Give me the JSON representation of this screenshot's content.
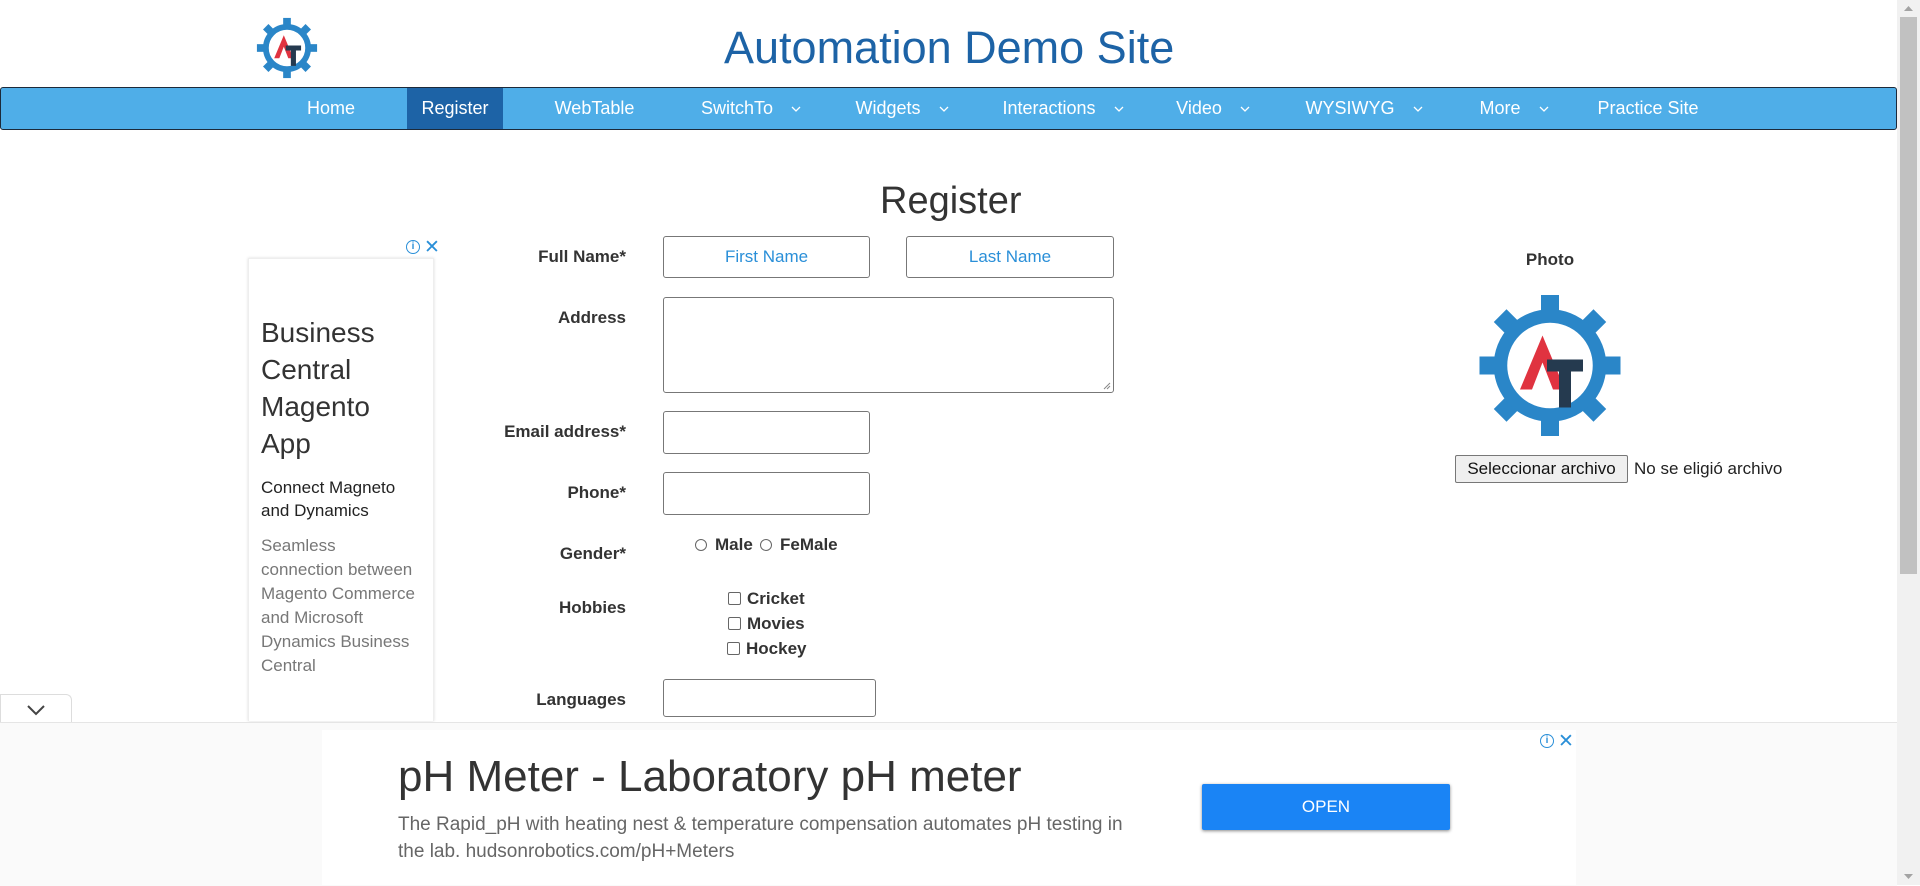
{
  "header": {
    "site_title": "Automation Demo Site"
  },
  "nav": {
    "items": [
      {
        "label": "Home"
      },
      {
        "label": "Register"
      },
      {
        "label": "WebTable"
      },
      {
        "label": "SwitchTo"
      },
      {
        "label": "Widgets"
      },
      {
        "label": "Interactions"
      },
      {
        "label": "Video"
      },
      {
        "label": "WYSIWYG"
      },
      {
        "label": "More"
      },
      {
        "label": "Practice Site"
      }
    ],
    "active": "Register"
  },
  "form": {
    "heading": "Register",
    "full_name_label": "Full Name*",
    "first_name_placeholder": "First Name",
    "last_name_placeholder": "Last Name",
    "address_label": "Address",
    "email_label": "Email address*",
    "phone_label": "Phone*",
    "gender_label": "Gender*",
    "gender_male": "Male",
    "gender_female": "FeMale",
    "hobbies_label": "Hobbies",
    "hobby_cricket": "Cricket",
    "hobby_movies": "Movies",
    "hobby_hockey": "Hockey",
    "languages_label": "Languages"
  },
  "photo": {
    "label": "Photo",
    "file_button": "Seleccionar archivo",
    "file_status": "No se eligió archivo"
  },
  "left_ad": {
    "title": "Business Central Magento App",
    "subtitle": "Connect Magneto and Dynamics",
    "body": "Seamless connection between Magento Commerce and Microsoft Dynamics Business Central"
  },
  "bottom_ad": {
    "title": "pH Meter - Laboratory pH meter",
    "description": "The Rapid_pH with heating nest & temperature compensation automates pH testing in the lab. hudsonrobotics.com/pH+Meters",
    "button": "OPEN"
  },
  "colors": {
    "nav_bg": "#4faee8",
    "nav_active": "#1d63a6",
    "title": "#1d63a6",
    "logo_blue": "#2a86c8",
    "logo_red": "#e03340",
    "logo_dark": "#253a4f",
    "open_button": "#1a84f5"
  },
  "icons": {
    "logo": "gear-logo",
    "ad_info": "info-icon",
    "ad_close": "close-icon",
    "collapse": "chevron-down-icon",
    "nav_dropdown": "chevron-down-icon"
  }
}
